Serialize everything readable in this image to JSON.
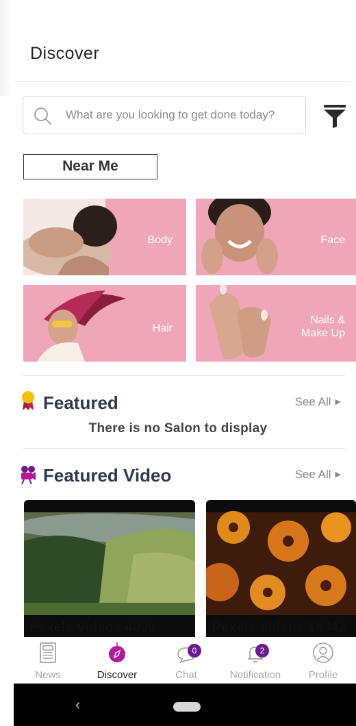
{
  "header": {
    "title": "Discover"
  },
  "search": {
    "placeholder": "What are you looking to get done today?",
    "value": ""
  },
  "near_me": {
    "label": "Near Me"
  },
  "categories": [
    {
      "label": "Body"
    },
    {
      "label": "Face"
    },
    {
      "label": "Hair"
    },
    {
      "label": "Nails &\nMake Up"
    }
  ],
  "featured": {
    "title": "Featured",
    "see_all": "See All",
    "empty_message": "There is no Salon to display"
  },
  "featured_video": {
    "title": "Featured Video",
    "see_all": "See All",
    "videos": [
      {
        "title": "Pexels Videos 4099"
      },
      {
        "title": "Pexels Videos 14942"
      }
    ]
  },
  "bottom_nav": {
    "items": [
      {
        "label": "News",
        "icon": "newspaper-icon"
      },
      {
        "label": "Discover",
        "icon": "compass-icon",
        "active": true
      },
      {
        "label": "Chat",
        "icon": "chat-icon",
        "badge": "0"
      },
      {
        "label": "Notification",
        "icon": "bell-icon",
        "badge": "2"
      },
      {
        "label": "Profile",
        "icon": "profile-icon"
      }
    ]
  },
  "colors": {
    "accent": "#b5179e",
    "badge": "#6b1d8f",
    "tile_pink": "#eea6b8",
    "title_navy": "#2f3a4f"
  }
}
